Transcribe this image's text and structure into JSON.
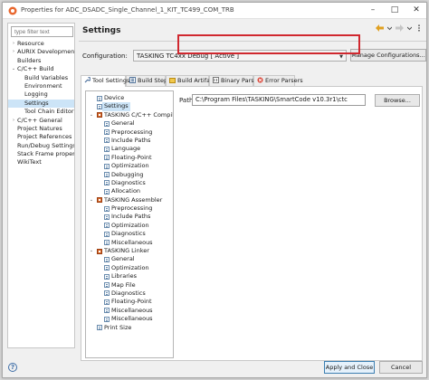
{
  "window": {
    "title": "Properties for ADC_DSADC_Single_Channel_1_KIT_TC499_COM_TRB",
    "controls": {
      "minimize": "–",
      "maximize": "□",
      "close": "✕"
    }
  },
  "left": {
    "filter_placeholder": "type filter text",
    "items": [
      {
        "label": "Resource",
        "expander": "›"
      },
      {
        "label": "AURIX Development",
        "expander": "›"
      },
      {
        "label": "Builders"
      },
      {
        "label": "C/C++ Build",
        "expander": "⌄"
      },
      {
        "label": "Build Variables"
      },
      {
        "label": "Environment"
      },
      {
        "label": "Logging"
      },
      {
        "label": "Settings"
      },
      {
        "label": "Tool Chain Editor"
      },
      {
        "label": "C/C++ General",
        "expander": "›"
      },
      {
        "label": "Project Natures"
      },
      {
        "label": "Project References"
      },
      {
        "label": "Run/Debug Settings"
      },
      {
        "label": "Stack Frame properti"
      },
      {
        "label": "WikiText"
      }
    ]
  },
  "page": {
    "title": "Settings"
  },
  "config": {
    "label": "Configuration:",
    "value": "TASKING TC4xx Debug  [ Active ]",
    "manage_label": "Manage Configurations..."
  },
  "tabs": [
    {
      "label": "Tool Settings"
    },
    {
      "label": "Build Steps"
    },
    {
      "label": "Build Artifact"
    },
    {
      "label": "Binary Parsers"
    },
    {
      "label": "Error Parsers"
    }
  ],
  "tree": {
    "items": [
      {
        "label": "Device"
      },
      {
        "label": "Settings"
      },
      {
        "label": "TASKING C/C++ Compiler",
        "expander": "⌄"
      },
      {
        "label": "General"
      },
      {
        "label": "Preprocessing"
      },
      {
        "label": "Include Paths"
      },
      {
        "label": "Language"
      },
      {
        "label": "Floating-Point"
      },
      {
        "label": "Optimization"
      },
      {
        "label": "Debugging"
      },
      {
        "label": "Diagnostics"
      },
      {
        "label": "Allocation"
      },
      {
        "label": "TASKING Assembler",
        "expander": "⌄"
      },
      {
        "label": "Preprocessing"
      },
      {
        "label": "Include Paths"
      },
      {
        "label": "Optimization"
      },
      {
        "label": "Diagnostics"
      },
      {
        "label": "Miscellaneous"
      },
      {
        "label": "TASKING Linker",
        "expander": "⌄"
      },
      {
        "label": "General"
      },
      {
        "label": "Optimization"
      },
      {
        "label": "Libraries"
      },
      {
        "label": "Map File"
      },
      {
        "label": "Diagnostics"
      },
      {
        "label": "Floating-Point"
      },
      {
        "label": "Miscellaneous"
      },
      {
        "label": "Miscellaneous"
      },
      {
        "label": "Print Size"
      }
    ]
  },
  "path": {
    "label": "Path",
    "value": "C:\\Program Files\\TASKING\\SmartCode v10.3r1\\ctc",
    "browse_label": "Browse..."
  },
  "footer": {
    "help_symbol": "?",
    "apply_close_label": "Apply and Close",
    "cancel_label": "Cancel"
  },
  "colors": {
    "selection": "#cce4f7",
    "highlight_box": "#d0282f",
    "tool_icon": "#d66b2e",
    "primary_button_border": "#3c7fb1"
  }
}
